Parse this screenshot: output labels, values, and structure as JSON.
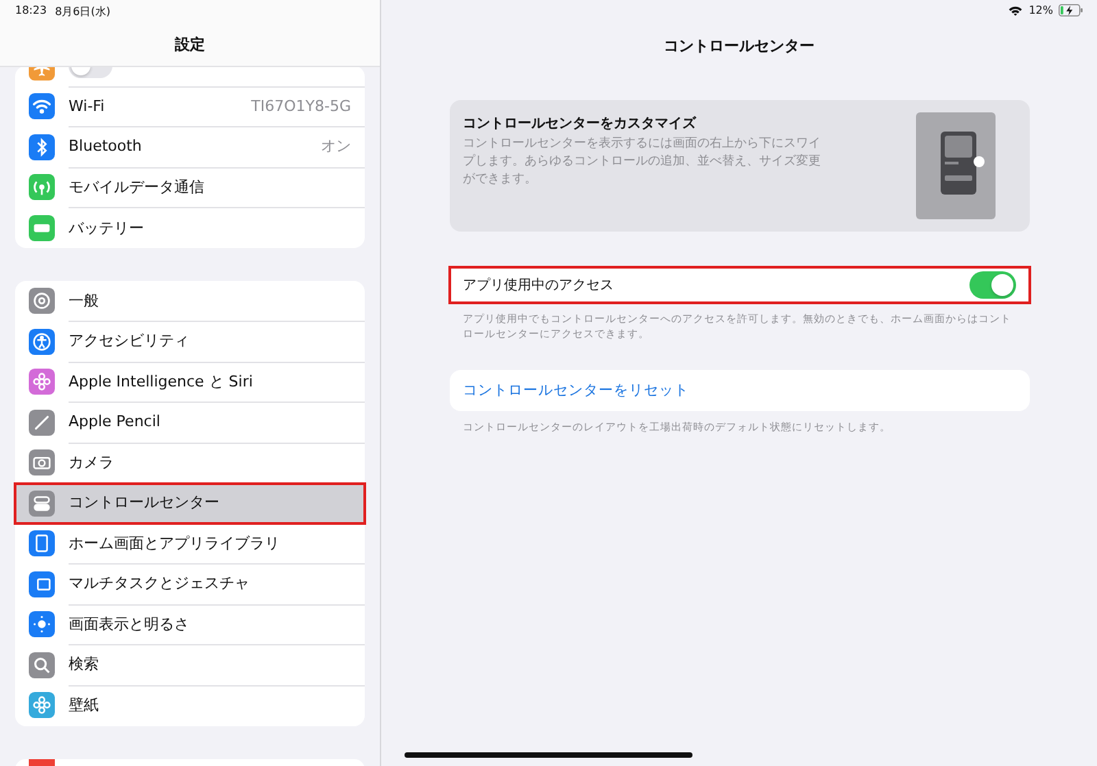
{
  "status_bar": {
    "time": "18:23",
    "date": "8月6日(水)",
    "battery": "12%",
    "charging": true
  },
  "sidebar": {
    "title": "設定",
    "groups": [
      {
        "items": [
          {
            "kind": "airplane",
            "on": false,
            "selected": false
          },
          {
            "kind": "wifi",
            "label": "Wi-Fi",
            "value": "TI67O1Y8-5G",
            "selected": false
          },
          {
            "kind": "bluetooth",
            "label": "Bluetooth",
            "value": "オン",
            "selected": false
          },
          {
            "kind": "cellular",
            "label": "モバイルデータ通信",
            "selected": false
          },
          {
            "kind": "battery",
            "label": "バッテリー",
            "selected": false
          }
        ]
      },
      {
        "items": [
          {
            "kind": "general",
            "label": "一般",
            "selected": false
          },
          {
            "kind": "accessibility",
            "label": "アクセシビリティ",
            "selected": false
          },
          {
            "kind": "siri",
            "label": "Apple Intelligence と Siri",
            "selected": false
          },
          {
            "kind": "pencil",
            "label": "Apple Pencil",
            "selected": false
          },
          {
            "kind": "camera",
            "label": "カメラ",
            "selected": false
          },
          {
            "kind": "control",
            "label": "コントロールセンター",
            "selected": true
          },
          {
            "kind": "home",
            "label": "ホーム画面とアプリライブラリ",
            "selected": false
          },
          {
            "kind": "multitask",
            "label": "マルチタスクとジェスチャ",
            "selected": false
          },
          {
            "kind": "display",
            "label": "画面表示と明るさ",
            "selected": false
          },
          {
            "kind": "search",
            "label": "検索",
            "selected": false
          },
          {
            "kind": "wallpaper",
            "label": "壁紙",
            "selected": false
          }
        ]
      },
      {
        "items": [
          {
            "kind": "red",
            "selected": false
          }
        ]
      }
    ]
  },
  "detail": {
    "title": "コントロールセンター",
    "card": {
      "heading": "コントロールセンターをカスタマイズ",
      "text": "コントロールセンターを表示するには画面の右上から下にスワイプします。あらゆるコントロールの追加、並べ替え、サイズ変更ができます。"
    },
    "access": {
      "label": "アプリ使用中のアクセス",
      "on": true,
      "highlighted": true,
      "note": "アプリ使用中でもコントロールセンターへのアクセスを許可します。無効のときでも、ホーム画面からはコントロールセンターにアクセスできます。"
    },
    "reset": {
      "label": "コントロールセンターをリセット",
      "note": "コントロールセンターのレイアウトを工場出荷時のデフォルト状態にリセットします。"
    }
  }
}
